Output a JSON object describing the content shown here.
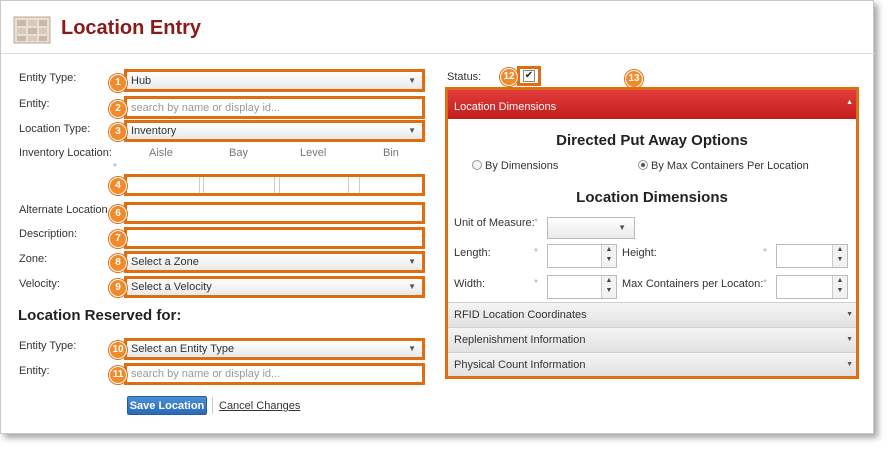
{
  "page": {
    "title": "Location Entry"
  },
  "form": {
    "entity_type": {
      "label": "Entity Type:",
      "value": "Hub",
      "badge": "1"
    },
    "entity": {
      "label": "Entity:",
      "placeholder": "search by name or display id...",
      "badge": "2"
    },
    "location_type": {
      "label": "Location Type:",
      "value": "Inventory",
      "badge": "3"
    },
    "inventory_location": {
      "label": "Inventory Location:",
      "columns": [
        "Aisle",
        "Bay",
        "Level",
        "Bin"
      ],
      "badge": "4"
    },
    "alternate_location": {
      "label": "Alternate Location",
      "badge": "6"
    },
    "description": {
      "label": "Description:",
      "badge": "7"
    },
    "zone": {
      "label": "Zone:",
      "value": "Select a Zone",
      "badge": "8"
    },
    "velocity": {
      "label": "Velocity:",
      "value": "Select a Velocity",
      "badge": "9"
    }
  },
  "reserved": {
    "heading": "Location Reserved for:",
    "entity_type": {
      "label": "Entity Type:",
      "value": "Select an Entity Type",
      "badge": "10"
    },
    "entity": {
      "label": "Entity:",
      "placeholder": "search by name or display id...",
      "badge": "11"
    }
  },
  "actions": {
    "save_label": "Save Location",
    "cancel_label": "Cancel Changes"
  },
  "status": {
    "label": "Status:",
    "checked": true,
    "badge": "12"
  },
  "panel": {
    "badge": "13",
    "header": "Location Dimensions",
    "put_away_title": "Directed Put Away Options",
    "radio_dimensions": "By Dimensions",
    "radio_max": "By Max Containers Per Location",
    "dimensions_title": "Location Dimensions",
    "uom_label": "Unit of Measure:",
    "length_label": "Length:",
    "height_label": "Height:",
    "width_label": "Width:",
    "max_containers_label": "Max Containers per Locaton:",
    "sections": [
      "RFID Location Coordinates",
      "Replenishment Information",
      "Physical Count Information"
    ]
  },
  "colors": {
    "accent": "#e06d10",
    "header_red": "#c21d1d",
    "title": "#8b1a1a",
    "button_blue": "#2a6ab8"
  }
}
